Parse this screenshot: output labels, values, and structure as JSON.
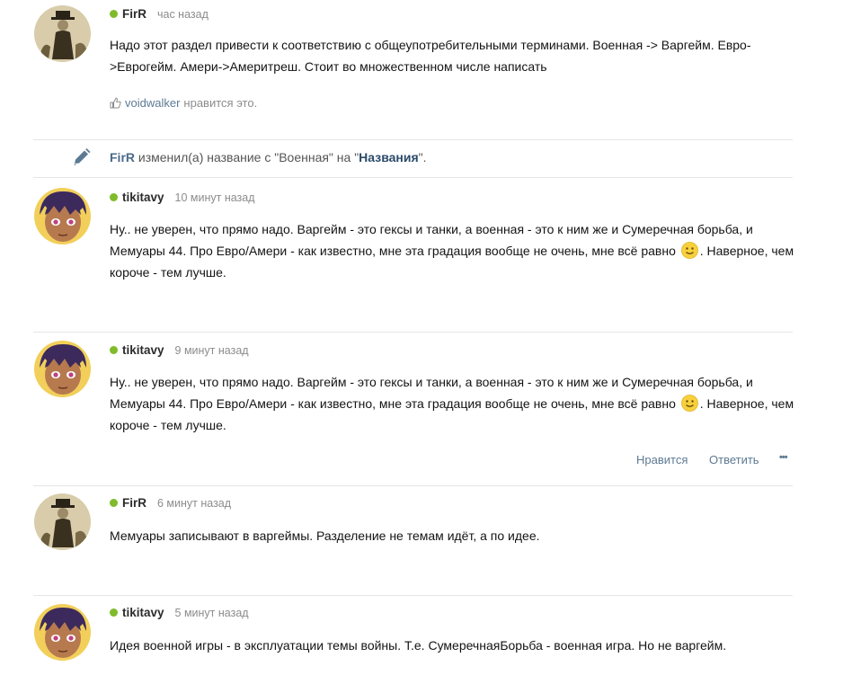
{
  "posts": [
    {
      "author": "FirR",
      "time": "час назад",
      "text": "Надо этот раздел привести к соответствию с общеупотребительными терминами. Военная -> Варгейм. Евро->Еврогейм. Амери->Америтреш. Стоит во множественном числе написать",
      "likes": {
        "user": "voidwalker",
        "text": "нравится это."
      }
    },
    {
      "author": "tikitavy",
      "time": "10 минут назад",
      "text_before": "Ну.. не уверен, что прямо надо. Варгейм - это гексы и танки, а военная - это к ним же и Сумеречная борьба, и Мемуары 44. Про Евро/Амери - как известно, мне эта градация вообще не очень, мне всё равно",
      "text_after": ". Наверное, чем короче - тем лучше."
    },
    {
      "author": "tikitavy",
      "time": "9 минут назад",
      "text_before": "Ну.. не уверен, что прямо надо. Варгейм - это гексы и танки, а военная - это к ним же и Сумеречная борьба, и Мемуары 44. Про Евро/Амери - как известно, мне эта градация вообще не очень, мне всё равно",
      "text_after": ". Наверное, чем короче - тем лучше.",
      "actions": {
        "like": "Нравится",
        "reply": "Ответить",
        "more": "•••"
      }
    },
    {
      "author": "FirR",
      "time": "6 минут назад",
      "text": "Мемуары записывают в варгеймы. Разделение не темам идёт, а по идее."
    },
    {
      "author": "tikitavy",
      "time": "5 минут назад",
      "text": "Идея военной игры - в эксплуатации темы войны. Т.е. СумеречнаяБорьба - военная игра. Но не варгейм."
    }
  ],
  "rename_event": {
    "user": "FirR",
    "text_mid": "изменил(а) название с \"Военная\" на \"",
    "new_name": "Названия",
    "text_end": "\"."
  }
}
